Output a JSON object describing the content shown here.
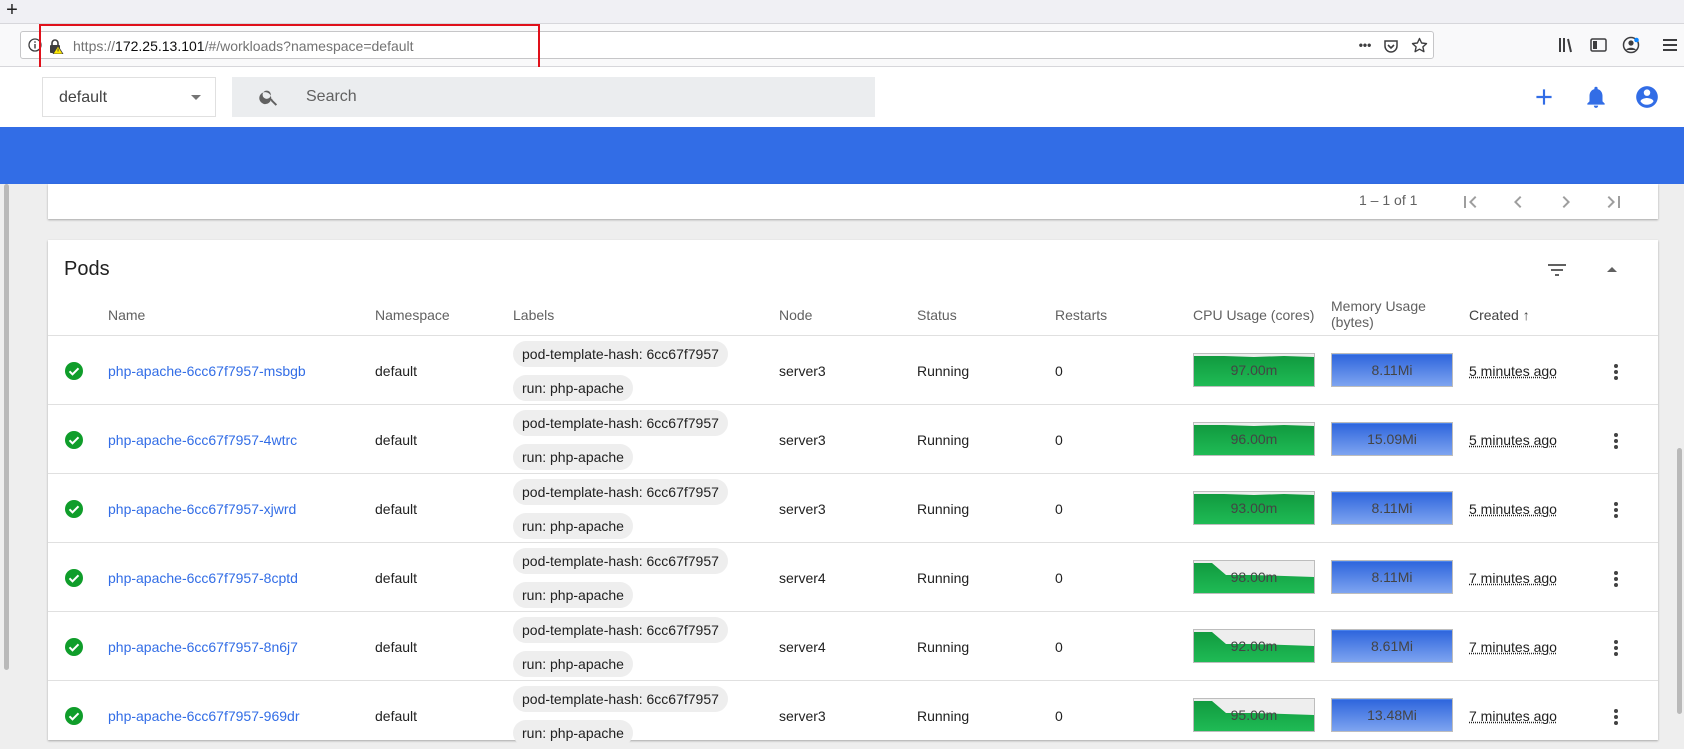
{
  "browser": {
    "new_tab_symbol": "+",
    "url_prefix": "https://",
    "url_host": "172.25.13.101",
    "url_path": "/#/workloads?namespace=default",
    "url_more": "•••",
    "icons": [
      "info-icon",
      "insecure-lock-icon",
      "page-actions-icon",
      "pocket-icon",
      "bookmark-star-icon",
      "library-icon",
      "sidebar-icon",
      "account-icon",
      "menu-icon"
    ]
  },
  "header": {
    "namespace": "default",
    "search_placeholder": "Search",
    "icons": [
      "search-icon",
      "plus-icon",
      "bell-icon",
      "account-circle-icon"
    ]
  },
  "pager": {
    "range_text": "1 – 1 of 1"
  },
  "pods": {
    "title": "Pods",
    "columns": {
      "name": "Name",
      "namespace": "Namespace",
      "labels": "Labels",
      "node": "Node",
      "status": "Status",
      "restarts": "Restarts",
      "cpu": "CPU Usage (cores)",
      "memory_line1": "Memory Usage",
      "memory_line2": "(bytes)",
      "created": "Created",
      "created_sort": "↑"
    },
    "rows": [
      {
        "name": "php-apache-6cc67f7957-msbgb",
        "namespace": "default",
        "label1": "pod-template-hash: 6cc67f7957",
        "label2": "run: php-apache",
        "node": "server3",
        "status": "Running",
        "restarts": "0",
        "cpu": "97.00m",
        "cpu_shape": "flat",
        "memory": "8.11Mi",
        "created": "5 minutes ago"
      },
      {
        "name": "php-apache-6cc67f7957-4wtrc",
        "namespace": "default",
        "label1": "pod-template-hash: 6cc67f7957",
        "label2": "run: php-apache",
        "node": "server3",
        "status": "Running",
        "restarts": "0",
        "cpu": "96.00m",
        "cpu_shape": "flat",
        "memory": "15.09Mi",
        "created": "5 minutes ago"
      },
      {
        "name": "php-apache-6cc67f7957-xjwrd",
        "namespace": "default",
        "label1": "pod-template-hash: 6cc67f7957",
        "label2": "run: php-apache",
        "node": "server3",
        "status": "Running",
        "restarts": "0",
        "cpu": "93.00m",
        "cpu_shape": "flat",
        "memory": "8.11Mi",
        "created": "5 minutes ago"
      },
      {
        "name": "php-apache-6cc67f7957-8cptd",
        "namespace": "default",
        "label1": "pod-template-hash: 6cc67f7957",
        "label2": "run: php-apache",
        "node": "server4",
        "status": "Running",
        "restarts": "0",
        "cpu": "98.00m",
        "cpu_shape": "drop",
        "memory": "8.11Mi",
        "created": "7 minutes ago"
      },
      {
        "name": "php-apache-6cc67f7957-8n6j7",
        "namespace": "default",
        "label1": "pod-template-hash: 6cc67f7957",
        "label2": "run: php-apache",
        "node": "server4",
        "status": "Running",
        "restarts": "0",
        "cpu": "92.00m",
        "cpu_shape": "drop",
        "memory": "8.61Mi",
        "created": "7 minutes ago"
      },
      {
        "name": "php-apache-6cc67f7957-969dr",
        "namespace": "default",
        "label1": "pod-template-hash: 6cc67f7957",
        "label2": "run: php-apache",
        "node": "server3",
        "status": "Running",
        "restarts": "0",
        "cpu": "95.00m",
        "cpu_shape": "drop",
        "memory": "13.48Mi",
        "created": "7 minutes ago"
      }
    ]
  },
  "colors": {
    "brand_blue": "#326de6",
    "cpu_green": "#1fbb55",
    "memory_blue": "#4a82ea",
    "status_green": "#0f9d2a",
    "highlight_red": "#e0101a"
  }
}
